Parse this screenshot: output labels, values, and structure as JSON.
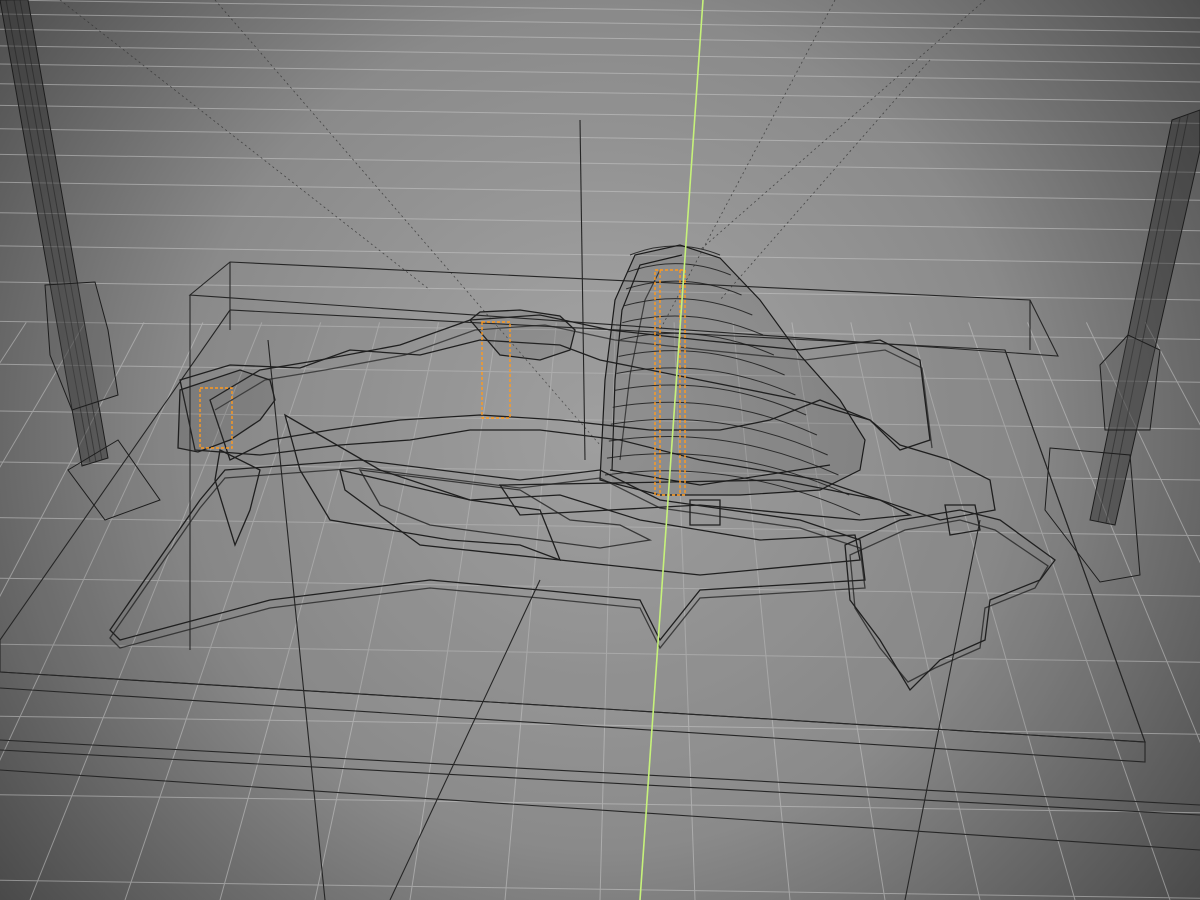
{
  "viewport": {
    "view_mode": "wireframe",
    "grid": true,
    "background_center": "#a6a6a6",
    "background_edge": "#4a4a4a",
    "grid_color": "#c8c8c8",
    "wire_color": "#2a2a2a",
    "axis_y_color": "#c6f27a",
    "selection_color": "#ff9a1f"
  },
  "scene": {
    "objects": [
      {
        "name": "terrain-contour-model",
        "kind": "wireframe-mesh",
        "selected": false
      },
      {
        "name": "base-plate",
        "kind": "wireframe-box",
        "selected": false
      },
      {
        "name": "support-rod-left",
        "kind": "wireframe-cylinder",
        "selected": false
      },
      {
        "name": "support-rod-right",
        "kind": "wireframe-cylinder",
        "selected": false
      },
      {
        "name": "highlighted-element-left",
        "kind": "selection",
        "selected": true
      },
      {
        "name": "highlighted-element-middle",
        "kind": "selection",
        "selected": true
      },
      {
        "name": "highlighted-element-peak",
        "kind": "selection",
        "selected": true
      }
    ]
  }
}
